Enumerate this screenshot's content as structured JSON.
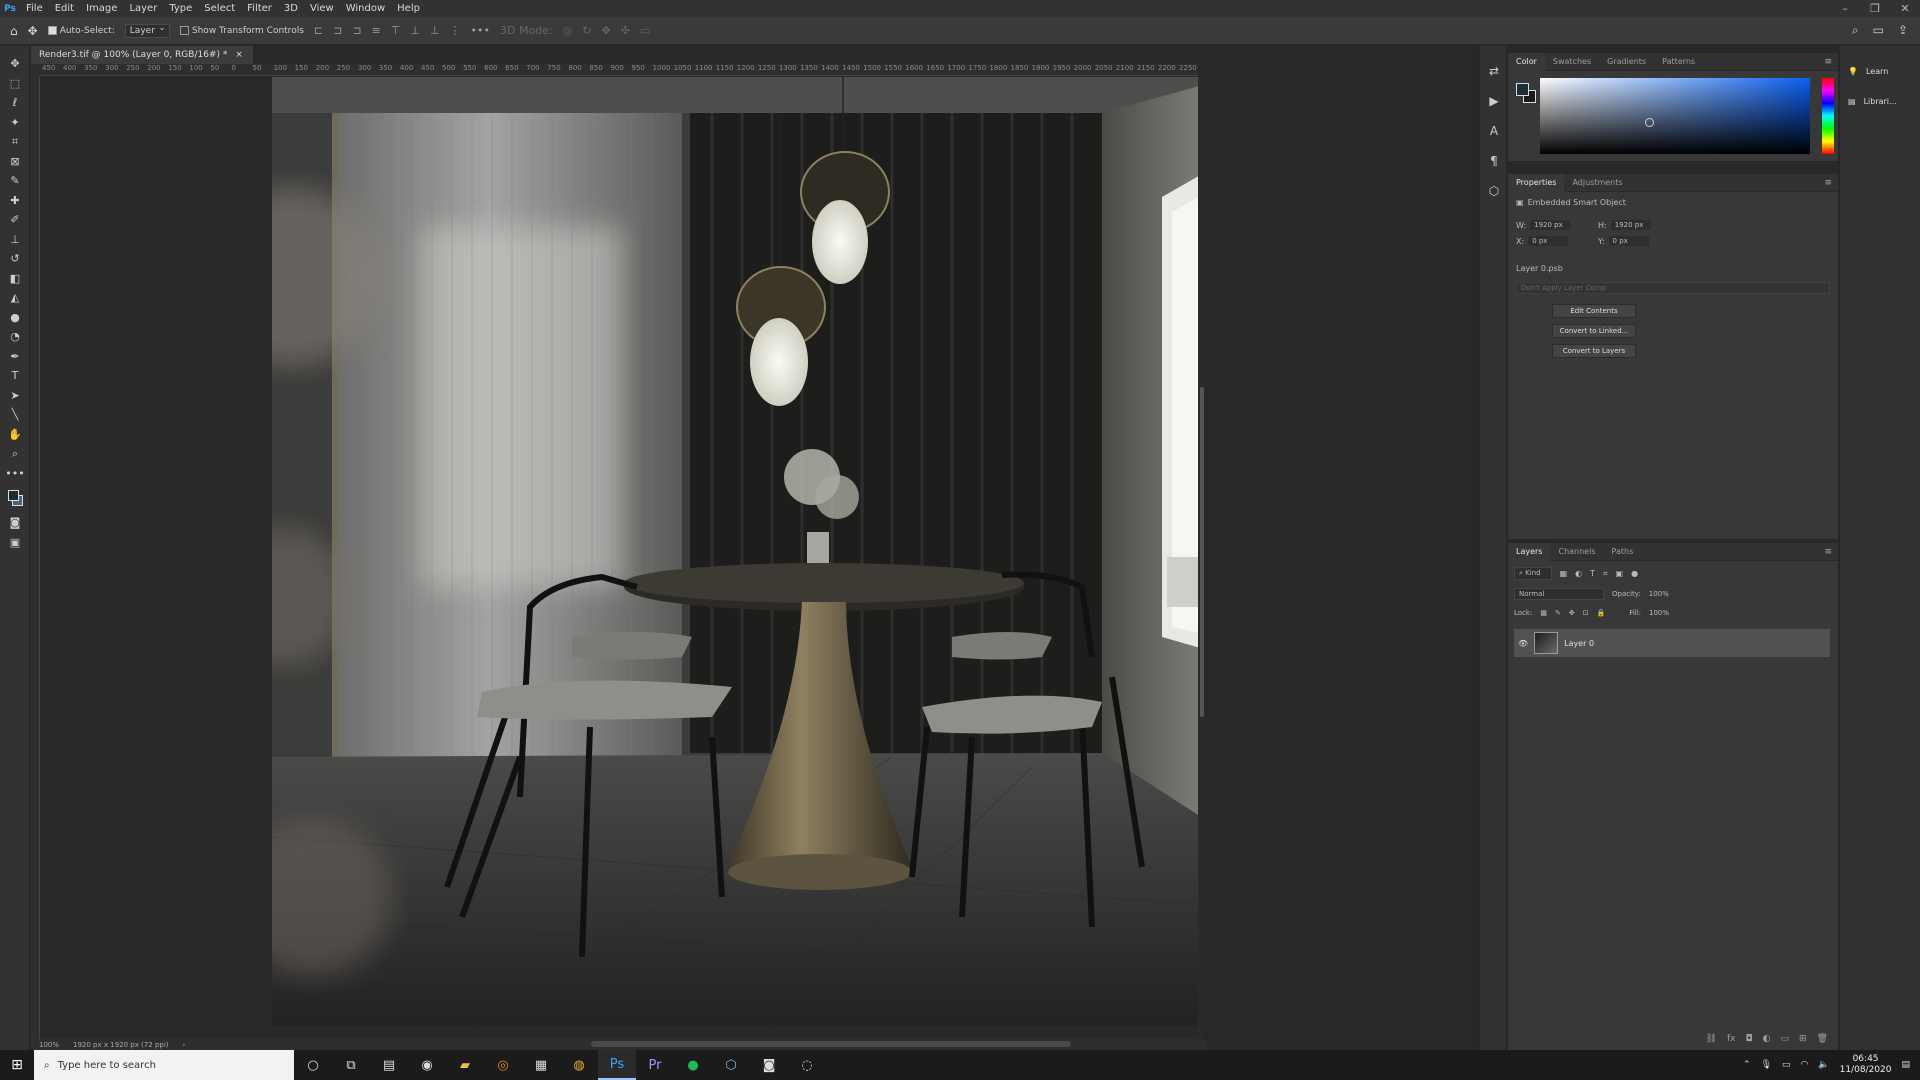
{
  "app": {
    "logo": "Ps",
    "menu": [
      "File",
      "Edit",
      "Image",
      "Layer",
      "Type",
      "Select",
      "Filter",
      "3D",
      "View",
      "Window",
      "Help"
    ],
    "window_controls": [
      "–",
      "❐",
      "✕"
    ]
  },
  "options_bar": {
    "auto_select_label": "Auto-Select:",
    "auto_select_target": "Layer",
    "show_transform_label": "Show Transform Controls",
    "mode_label": "3D Mode:"
  },
  "document": {
    "tab_title": "Render3.tif @ 100% (Layer 0, RGB/16#) *",
    "close_glyph": "×"
  },
  "ruler_ticks": [
    "450",
    "400",
    "350",
    "300",
    "250",
    "200",
    "150",
    "100",
    "50",
    "0",
    "50",
    "100",
    "150",
    "200",
    "250",
    "300",
    "350",
    "400",
    "450",
    "500",
    "550",
    "600",
    "650",
    "700",
    "750",
    "800",
    "850",
    "900",
    "950",
    "1000",
    "1050",
    "1100",
    "1150",
    "1200",
    "1250",
    "1300",
    "1350",
    "1400",
    "1450",
    "1500",
    "1550",
    "1600",
    "1650",
    "1700",
    "1750",
    "1800",
    "1850",
    "1900",
    "1950",
    "2000",
    "2050",
    "2100",
    "2150",
    "2200",
    "2250"
  ],
  "status_bar": {
    "zoom": "100%",
    "doc_info": "1920 px x 1920 px (72 ppi)",
    "arrow": "›"
  },
  "color_panel": {
    "tabs": [
      "Color",
      "Swatches",
      "Gradients",
      "Patterns"
    ],
    "menu_glyph": "≡",
    "fg_color": "#1d2f3a",
    "bg_color": "#1a1a1a"
  },
  "properties_panel": {
    "tabs": [
      "Properties",
      "Adjustments"
    ],
    "menu_glyph": "≡",
    "type_label": "Embedded Smart Object",
    "w_label": "W:",
    "w_value": "1920 px",
    "h_label": "H:",
    "h_value": "1920 px",
    "x_label": "X:",
    "x_value": "0 px",
    "y_label": "Y:",
    "y_value": "0 px",
    "source_file": "Layer 0.psb",
    "layer_comp_placeholder": "Don't Apply Layer Comp",
    "buttons": [
      "Edit Contents",
      "Convert to Linked...",
      "Convert to Layers"
    ]
  },
  "layers_panel": {
    "tabs": [
      "Layers",
      "Channels",
      "Paths"
    ],
    "menu_glyph": "≡",
    "filter_kind": "Kind",
    "blend_mode": "Normal",
    "opacity_label": "Opacity:",
    "opacity_value": "100%",
    "lock_label": "Lock:",
    "fill_label": "Fill:",
    "fill_value": "100%",
    "layers": [
      {
        "name": "Layer 0",
        "visible": true
      }
    ],
    "footer_icons": [
      "link-icon",
      "fx-icon",
      "mask-icon",
      "adjustment-icon",
      "folder-icon",
      "new-layer-icon",
      "trash-icon"
    ],
    "footer_glyphs": [
      "⛓",
      "fx",
      "◘",
      "◐",
      "▭",
      "⊞",
      "🗑"
    ]
  },
  "far_right_panel": {
    "items": [
      {
        "label": "Learn",
        "icon": "💡"
      },
      {
        "label": "Librari...",
        "icon": "▤"
      }
    ]
  },
  "taskbar": {
    "search_placeholder": "Type here to search",
    "time": "06:45",
    "date": "11/08/2020"
  }
}
